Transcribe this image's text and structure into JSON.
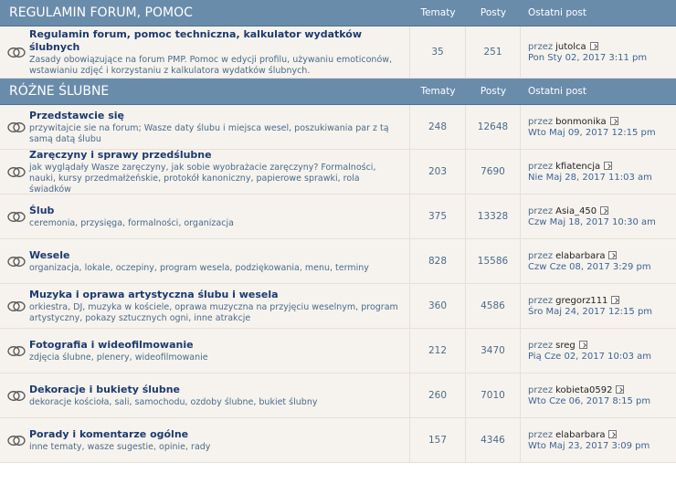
{
  "columns": {
    "topics": "Tematy",
    "posts": "Posty",
    "last_post": "Ostatni post"
  },
  "categories": [
    {
      "title": "REGULAMIN FORUM, POMOC",
      "forums": [
        {
          "title": "Regulamin forum, pomoc techniczna, kalkulator wydatków ślubnych",
          "description": "Zasady obowiązujące na forum PMP. Pomoc w edycji profilu, używaniu emoticonów, wstawianiu zdjęć i korzystaniu z kalkulatora wydatków ślubnych.",
          "topics": "35",
          "posts": "251",
          "by": "przez",
          "author": "jutolca",
          "date": "Pon Sty 02, 2017 3:11 pm"
        }
      ]
    },
    {
      "title": "RÓŻNE ŚLUBNE",
      "forums": [
        {
          "title": "Przedstawcie się",
          "description": "przywitajcie sie na forum; Wasze daty ślubu i miejsca wesel, poszukiwania par z tą samą datą ślubu",
          "topics": "248",
          "posts": "12648",
          "by": "przez",
          "author": "bonmonika",
          "date": "Wto Maj 09, 2017 12:15 pm"
        },
        {
          "title": "Zaręczyny i sprawy przedślubne",
          "description": "jak wyglądały Wasze zaręczyny, jak sobie wyobrażacie zaręczyny? Formalności, nauki, kursy przedmałżeńskie, protokół kanoniczny, papierowe sprawki, rola świadków",
          "topics": "203",
          "posts": "7690",
          "by": "przez",
          "author": "kfiatencja",
          "date": "Nie Maj 28, 2017 11:03 am"
        },
        {
          "title": "Ślub",
          "description": "ceremonia, przysięga, formalności, organizacja",
          "topics": "375",
          "posts": "13328",
          "by": "przez",
          "author": "Asia_450",
          "date": "Czw Maj 18, 2017 10:30 am"
        },
        {
          "title": "Wesele",
          "description": "organizacja, lokale, oczepiny, program wesela, podziękowania, menu, terminy",
          "topics": "828",
          "posts": "15586",
          "by": "przez",
          "author": "elabarbara",
          "date": "Czw Cze 08, 2017 3:29 pm"
        },
        {
          "title": "Muzyka i oprawa artystyczna ślubu i wesela",
          "description": "orkiestra, DJ, muzyka w kościele, oprawa muzyczna na przyjęciu weselnym, program artystyczny, pokazy sztucznych ogni, inne atrakcje",
          "topics": "360",
          "posts": "4586",
          "by": "przez",
          "author": "gregorz111",
          "date": "Śro Maj 24, 2017 12:15 pm"
        },
        {
          "title": "Fotografia i wideofilmowanie",
          "description": "zdjęcia ślubne, plenery, wideofilmowanie",
          "topics": "212",
          "posts": "3470",
          "by": "przez",
          "author": "sreg",
          "date": "Pią Cze 02, 2017 10:03 am"
        },
        {
          "title": "Dekoracje i bukiety ślubne",
          "description": "dekoracje kościoła, sali, samochodu, ozdoby ślubne, bukiet ślubny",
          "topics": "260",
          "posts": "7010",
          "by": "przez",
          "author": "kobieta0592",
          "date": "Wto Cze 06, 2017 8:15 pm"
        },
        {
          "title": "Porady i komentarze ogólne",
          "description": "inne tematy, wasze sugestie, opinie, rady",
          "topics": "157",
          "posts": "4346",
          "by": "przez",
          "author": "elabarbara",
          "date": "Wto Maj 23, 2017 3:09 pm"
        }
      ]
    }
  ]
}
